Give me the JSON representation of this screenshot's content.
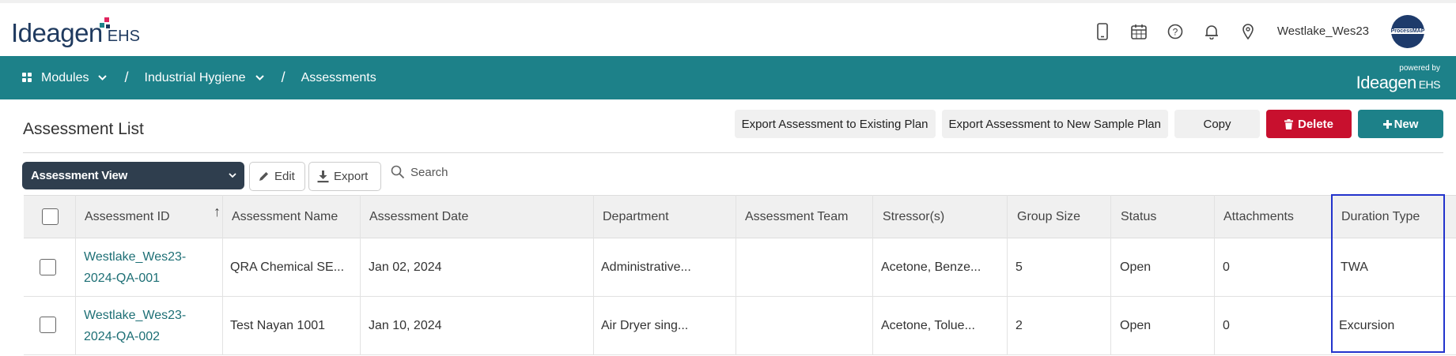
{
  "header": {
    "logo_text": "Ideagen",
    "logo_suffix": "EHS",
    "username": "Westlake_Wes23",
    "avatar_text": "ProcessMAP",
    "icons": [
      "mobile-icon",
      "calendar-icon",
      "help-icon",
      "bell-icon",
      "location-pin-icon"
    ]
  },
  "nav": {
    "breadcrumbs": [
      "Modules",
      "Industrial Hygiene",
      "Assessments"
    ],
    "powered_by": "powered by",
    "powered_brand": "Ideagen",
    "powered_suffix": "EHS"
  },
  "page": {
    "title": "Assessment List",
    "actions": {
      "export_existing": "Export Assessment to Existing Plan",
      "export_new": "Export Assessment to New Sample Plan",
      "copy": "Copy",
      "delete": "Delete",
      "new": "New"
    }
  },
  "toolbar": {
    "view": "Assessment View",
    "edit": "Edit",
    "export": "Export",
    "search": "Search"
  },
  "table": {
    "columns": [
      "Assessment ID",
      "Assessment Name",
      "Assessment Date",
      "Department",
      "Assessment Team",
      "Stressor(s)",
      "Group Size",
      "Status",
      "Attachments",
      "Duration Type"
    ],
    "sort_indicator": "↑",
    "rows": [
      {
        "id_line1": "Westlake_Wes23-",
        "id_line2": "2024-QA-001",
        "name": "QRA Chemical SE...",
        "date": "Jan 02, 2024",
        "department": "Administrative...",
        "team": "",
        "stressors": "Acetone, Benze...",
        "group_size": "5",
        "status": "Open",
        "attachments": "0",
        "duration_type": "TWA"
      },
      {
        "id_line1": "Westlake_Wes23-",
        "id_line2": "2024-QA-002",
        "name": "Test Nayan 1001",
        "date": "Jan 10, 2024",
        "department": "Air Dryer sing...",
        "team": "",
        "stressors": "Acetone, Tolue...",
        "group_size": "2",
        "status": "Open",
        "attachments": "0",
        "duration_type": "Excursion"
      }
    ]
  },
  "colors": {
    "teal": "#1d8189",
    "delete_red": "#c8102e",
    "highlight_blue": "#2233cc",
    "dark_select": "#2f3e4e"
  }
}
